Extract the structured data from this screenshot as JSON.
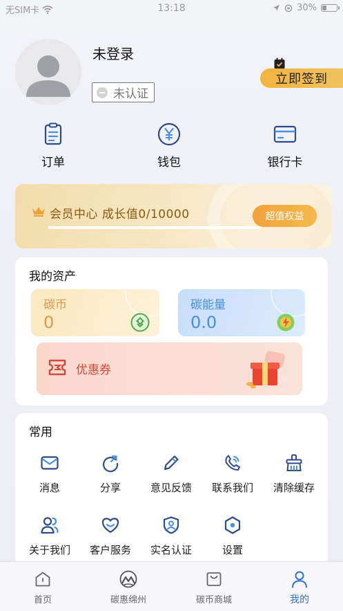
{
  "status_bar": {
    "carrier": "无SIM卡",
    "time": "13:18",
    "battery": "30%",
    "battery_level": 0.3
  },
  "profile": {
    "username": "未登录",
    "auth_status": "未认证",
    "checkin_label": "立即签到"
  },
  "quick_actions": [
    {
      "label": "订单",
      "icon": "order-icon"
    },
    {
      "label": "钱包",
      "icon": "wallet-icon"
    },
    {
      "label": "银行卡",
      "icon": "bank-card-icon"
    }
  ],
  "member": {
    "title": "会员中心 成长值0/10000",
    "growth_value": 0,
    "growth_max": 10000,
    "perk_button": "超值权益"
  },
  "assets": {
    "title": "我的资产",
    "carbon_coin": {
      "label": "碳币",
      "value": "0"
    },
    "carbon_energy": {
      "label": "碳能量",
      "value": "0.0"
    },
    "coupon": {
      "label": "优惠券"
    }
  },
  "common": {
    "title": "常用",
    "items": [
      {
        "label": "消息",
        "icon": "mail-icon"
      },
      {
        "label": "分享",
        "icon": "share-icon"
      },
      {
        "label": "意见反馈",
        "icon": "pencil-icon"
      },
      {
        "label": "联系我们",
        "icon": "phone-icon"
      },
      {
        "label": "清除缓存",
        "icon": "broom-icon"
      },
      {
        "label": "关于我们",
        "icon": "users-icon"
      },
      {
        "label": "客户服务",
        "icon": "heart-icon"
      },
      {
        "label": "实名认证",
        "icon": "shield-user-icon"
      },
      {
        "label": "设置",
        "icon": "settings-icon"
      }
    ]
  },
  "tabs": [
    {
      "label": "首页",
      "icon": "home-icon",
      "active": false
    },
    {
      "label": "碳惠绵州",
      "icon": "mountain-logo-icon",
      "active": false
    },
    {
      "label": "碳币商城",
      "icon": "shop-icon",
      "active": false
    },
    {
      "label": "我的",
      "icon": "person-icon",
      "active": true
    }
  ],
  "colors": {
    "accent_blue": "#2f6fd8",
    "gold": "#f3b33f",
    "coin_text": "#d49a52",
    "energy_text": "#4a8ee0",
    "coupon_text": "#cf4a3a"
  }
}
